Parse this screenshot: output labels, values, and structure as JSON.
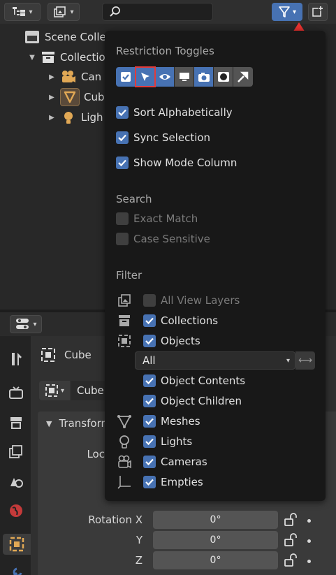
{
  "outliner": {
    "tree": [
      {
        "label": "Scene Colle",
        "icon": "scene-collection-icon"
      },
      {
        "label": "Collectio",
        "icon": "collection-icon"
      },
      {
        "label": "Can",
        "icon": "camera-icon"
      },
      {
        "label": "Cub",
        "icon": "mesh-icon"
      },
      {
        "label": "Ligh",
        "icon": "light-icon"
      }
    ]
  },
  "popover": {
    "restriction_title": "Restriction Toggles",
    "restriction_toggles": [
      {
        "name": "checkbox-toggle-icon",
        "state": "on"
      },
      {
        "name": "select-cursor-icon",
        "state": "on",
        "highlighted": true
      },
      {
        "name": "eye-icon",
        "state": "on"
      },
      {
        "name": "monitor-icon",
        "state": "off"
      },
      {
        "name": "camera-render-icon",
        "state": "on"
      },
      {
        "name": "holdout-icon",
        "state": "off"
      },
      {
        "name": "indirect-only-icon",
        "state": "off"
      }
    ],
    "options": [
      {
        "label": "Sort Alphabetically",
        "checked": true
      },
      {
        "label": "Sync Selection",
        "checked": true
      },
      {
        "label": "Show Mode Column",
        "checked": true
      }
    ],
    "search_title": "Search",
    "search_options": [
      {
        "label": "Exact Match",
        "checked": false
      },
      {
        "label": "Case Sensitive",
        "checked": false
      }
    ],
    "filter_title": "Filter",
    "filter_all_view_layers": "All View Layers",
    "filter_collections": "Collections",
    "filter_objects": "Objects",
    "object_type_dropdown": "All",
    "filter_object_contents": "Object Contents",
    "filter_object_children": "Object Children",
    "filter_meshes": "Meshes",
    "filter_lights": "Lights",
    "filter_cameras": "Cameras",
    "filter_empties": "Empties"
  },
  "properties": {
    "object_name": "Cube",
    "object_field": "Cube",
    "panel_transform": "Transform",
    "location_label": "Loc",
    "rotation_x_label": "Rotation X",
    "rotation_y_label": "Y",
    "rotation_z_label": "Z",
    "rotation_x": "0°",
    "rotation_y": "0°",
    "rotation_z": "0°"
  },
  "colors": {
    "accent": "#4772b3",
    "highlight": "#e23b3b",
    "popover_bg": "#181818"
  }
}
